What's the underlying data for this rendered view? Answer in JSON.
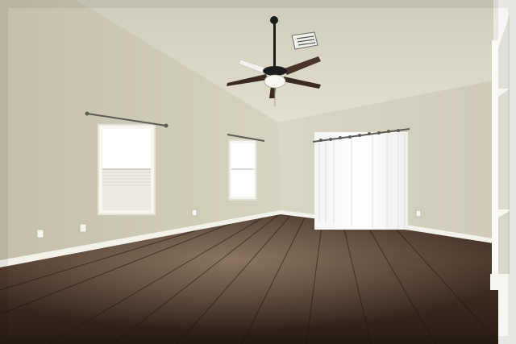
{
  "scene": {
    "kind": "photo",
    "subject": "empty room",
    "colors": {
      "left_wall": "#cfcbb6",
      "back_wall": "#d6d3c2",
      "ceiling": "#dcd9c9",
      "floor_dark": "#2a1d17",
      "floor_mid": "#4a3426",
      "floor_light": "#7a6452",
      "baseboard": "#f2f1ea",
      "window_glow": "#ffffff",
      "fan_blade": "#3a2a22",
      "fan_metal": "#1c1c1c"
    },
    "elements": [
      "ceiling-fan",
      "ceiling-vent",
      "left-window",
      "middle-window",
      "curtained-window",
      "curtain-rods",
      "electrical-outlets",
      "baseboards",
      "hardwood-floor",
      "open-shelf-frame"
    ]
  }
}
